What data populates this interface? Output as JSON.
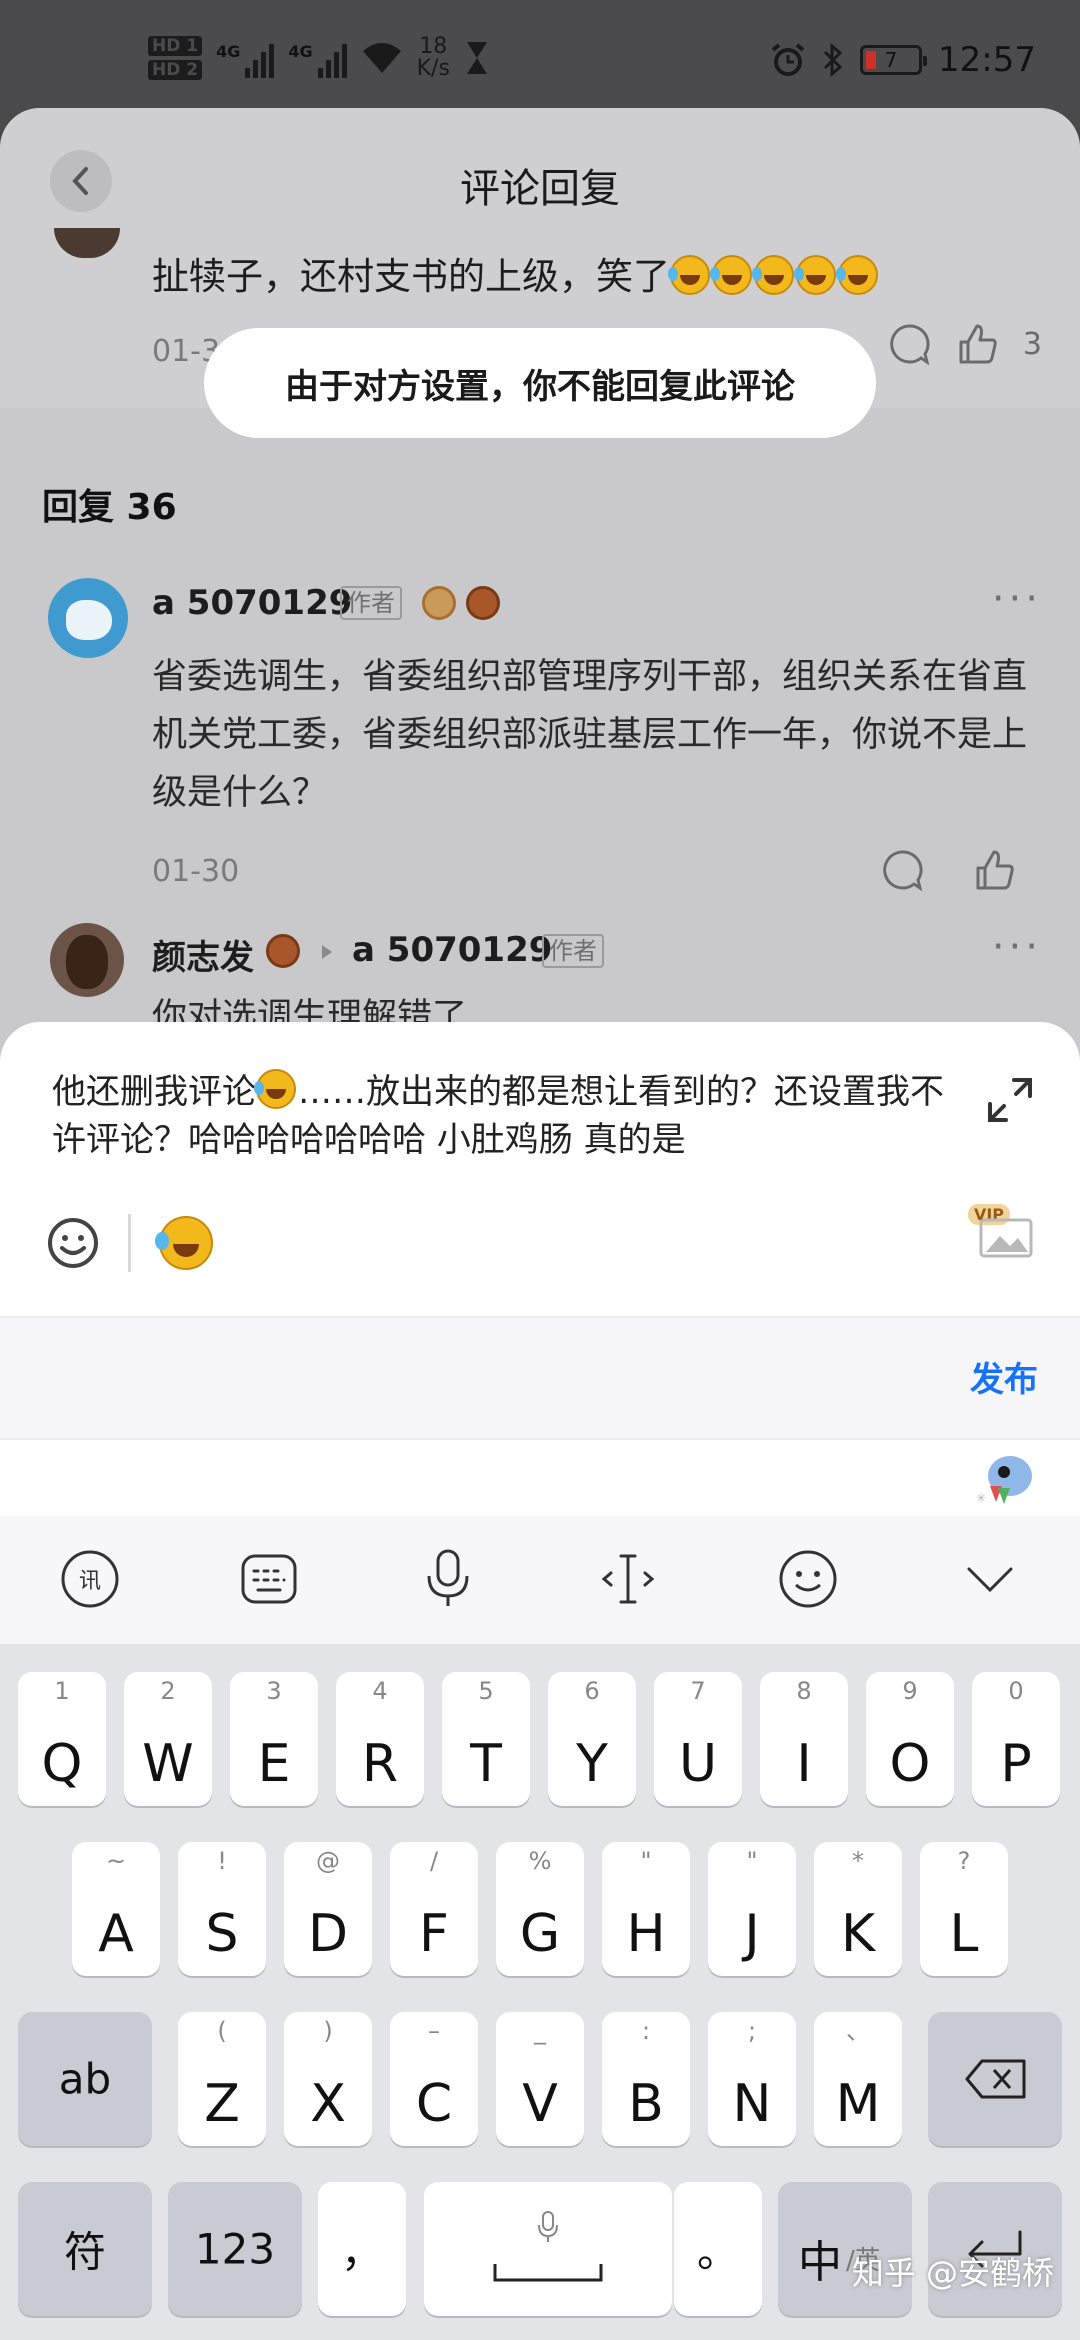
{
  "status_bar": {
    "hd1": "HD 1",
    "hd2": "HD 2",
    "net1": "4G",
    "net2": "4G",
    "speed_value": "18",
    "speed_unit": "K/s",
    "battery": "7",
    "time": "12:57"
  },
  "header": {
    "title": "评论回复"
  },
  "parent_comment": {
    "text": "扯犊子，还村支书的上级，笑了",
    "date": "01-3",
    "like_count": "3"
  },
  "toast": {
    "message": "由于对方设置，你不能回复此评论"
  },
  "replies": {
    "count_label": "回复 36",
    "items": [
      {
        "author": "a 5070129",
        "author_tag": "作者",
        "text": "省委选调生，省委组织部管理序列干部，组织关系在省直机关党工委，省委组织部派驻基层工作一年，你说不是上级是什么？",
        "date": "01-30"
      },
      {
        "author": "颜志发",
        "reply_to": "a 5070129",
        "reply_to_tag": "作者",
        "text": "你对选调生理解错了"
      }
    ]
  },
  "composer": {
    "draft_part1": "他还删我评论",
    "draft_part2": "……放出来的都是想让看到的？还设置我不许评论？哈哈哈哈哈哈哈  小肚鸡肠 真的是",
    "vip_label": "VIP",
    "publish_label": "发布"
  },
  "keyboard": {
    "row1": [
      {
        "main": "Q",
        "sub": "1"
      },
      {
        "main": "W",
        "sub": "2"
      },
      {
        "main": "E",
        "sub": "3"
      },
      {
        "main": "R",
        "sub": "4"
      },
      {
        "main": "T",
        "sub": "5"
      },
      {
        "main": "Y",
        "sub": "6"
      },
      {
        "main": "U",
        "sub": "7"
      },
      {
        "main": "I",
        "sub": "8"
      },
      {
        "main": "O",
        "sub": "9"
      },
      {
        "main": "P",
        "sub": "0"
      }
    ],
    "row2": [
      {
        "main": "A",
        "sub": "~"
      },
      {
        "main": "S",
        "sub": "!"
      },
      {
        "main": "D",
        "sub": "@"
      },
      {
        "main": "F",
        "sub": "/"
      },
      {
        "main": "G",
        "sub": "%"
      },
      {
        "main": "H",
        "sub": "\""
      },
      {
        "main": "J",
        "sub": "\""
      },
      {
        "main": "K",
        "sub": "*"
      },
      {
        "main": "L",
        "sub": "?"
      }
    ],
    "row3": [
      {
        "main": "Z",
        "sub": "("
      },
      {
        "main": "X",
        "sub": ")"
      },
      {
        "main": "C",
        "sub": "–"
      },
      {
        "main": "V",
        "sub": "_"
      },
      {
        "main": "B",
        "sub": ":"
      },
      {
        "main": "N",
        "sub": ";"
      },
      {
        "main": "M",
        "sub": "、"
      }
    ],
    "shift_label": "ab",
    "symbol_label": "符",
    "number_label": "123",
    "comma_label": "，",
    "period_label": "。",
    "lang_main": "中",
    "lang_sub": "/英"
  },
  "watermark": "知乎 @安鹤桥"
}
